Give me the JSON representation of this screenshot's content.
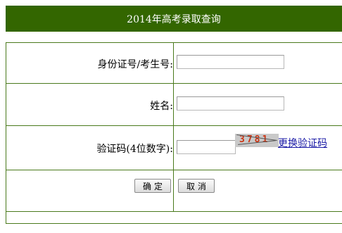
{
  "header": {
    "title": "2014年高考录取查询"
  },
  "form": {
    "id_field": {
      "label": "身份证号/考生号:",
      "value": "",
      "placeholder": ""
    },
    "name_field": {
      "label": "姓名:",
      "value": "",
      "placeholder": ""
    },
    "captcha_field": {
      "label": "验证码(4位数字):",
      "value": "",
      "placeholder": "",
      "captcha_image_text": "3781",
      "refresh_link": "更换验证码"
    }
  },
  "buttons": {
    "confirm_label": "确定",
    "cancel_label": "取消"
  },
  "colors": {
    "header_bg": "#336600",
    "border": "#4a7a1c",
    "link": "#1a1aa6",
    "captcha_text": "#cc3311"
  }
}
